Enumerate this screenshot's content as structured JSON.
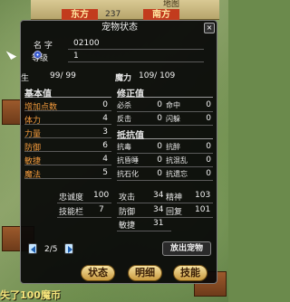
{
  "map": {
    "title": "地图",
    "dir_left": "东方",
    "coord": "237",
    "dir_right": "南方"
  },
  "bottom_message": "失了100魔币",
  "panel": {
    "title": "宠物状态",
    "close_label": "×",
    "name_label": "名  字",
    "name_value": "02100",
    "level_label": "等级",
    "level_value": "1",
    "hp_label": "生",
    "hp_value": "99/  99",
    "mp_label": "魔力",
    "mp_value": "109/ 109",
    "base_head": "基本值",
    "base_stats": [
      {
        "label": "增加点数",
        "value": "0"
      },
      {
        "label": "体力",
        "value": "4"
      },
      {
        "label": "力量",
        "value": "3"
      },
      {
        "label": "防御",
        "value": "6"
      },
      {
        "label": "敏捷",
        "value": "4"
      },
      {
        "label": "魔法",
        "value": "5"
      }
    ],
    "correct_head": "修正值",
    "correct_stats": [
      {
        "label": "必杀",
        "value": "0",
        "label2": "命中",
        "value2": "0"
      },
      {
        "label": "反击",
        "value": "0",
        "label2": "闪躲",
        "value2": "0"
      }
    ],
    "resist_head": "抵抗值",
    "resist_stats": [
      {
        "label": "抗毒",
        "value": "0",
        "label2": "抗醉",
        "value2": "0"
      },
      {
        "label": "抗昏睡",
        "value": "0",
        "label2": "抗混乱",
        "value2": "0"
      },
      {
        "label": "抗石化",
        "value": "0",
        "label2": "抗遗忘",
        "value2": "0"
      }
    ],
    "loyalty_label": "忠诚度",
    "loyalty_value": "100",
    "skill_slot_label": "技能栏",
    "skill_slot_value": "7",
    "attack_label": "攻击",
    "attack_value": "34",
    "defense_label": "防御",
    "defense_value": "34",
    "agility_label": "敏捷",
    "agility_value": "31",
    "spirit_label": "精神",
    "spirit_value": "103",
    "recovery_label": "回复",
    "recovery_value": "101",
    "page": "2/5",
    "release_button": "放出宠物",
    "state_button": "状态",
    "detail_button": "明细",
    "skill_button": "技能"
  },
  "colors": {
    "panel_bg": "#080808",
    "stat_label": "#f29a3c",
    "button_gold": "#c99a3f"
  }
}
